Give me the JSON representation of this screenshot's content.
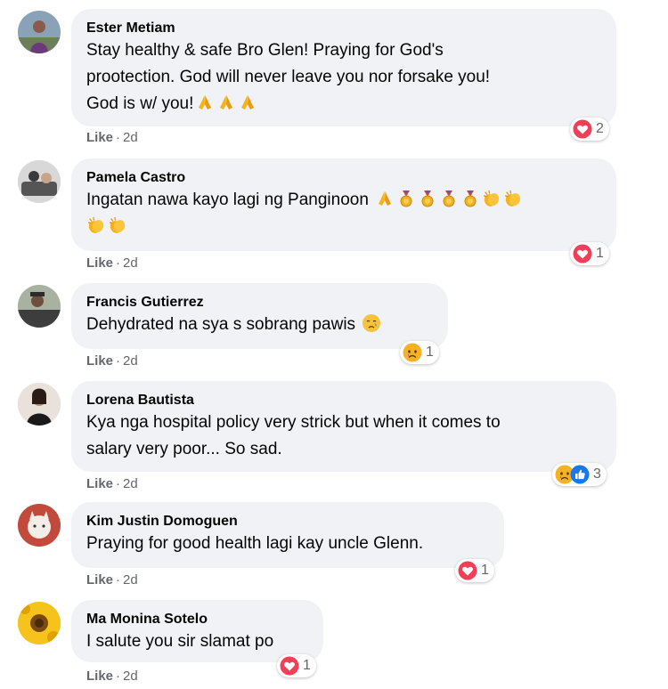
{
  "colors": {
    "bubble": "#f0f2f5",
    "meta": "#65676b",
    "heart": "#f33e58",
    "like": "#1877f2",
    "sad": "#f7b125"
  },
  "comments": [
    {
      "author": "Ester Metiam",
      "lines": [
        "Stay healthy & safe Bro Glen! Praying for God's",
        "prootection. God will never leave you nor forsake you!",
        "God is w/ you!"
      ],
      "emojis": [
        "folded-hands",
        "folded-hands",
        "folded-hands"
      ],
      "like": "Like",
      "time": "2d",
      "reactions": [
        "heart"
      ],
      "reaction_count": "2"
    },
    {
      "author": "Pamela Castro",
      "lines": [
        "Ingatan nawa kayo lagi ng Panginoon",
        ""
      ],
      "emojis": [
        "folded-hands",
        "medal",
        "medal",
        "medal",
        "medal",
        "clapping-hands",
        "clapping-hands",
        "clapping-hands",
        "clapping-hands"
      ],
      "like": "Like",
      "time": "2d",
      "reactions": [
        "heart"
      ],
      "reaction_count": "1"
    },
    {
      "author": "Francis Gutierrez",
      "lines": [
        "Dehydrated na sya s sobrang pawis"
      ],
      "emojis": [
        "sad-face"
      ],
      "like": "Like",
      "time": "2d",
      "reactions": [
        "sad"
      ],
      "reaction_count": "1"
    },
    {
      "author": "Lorena Bautista",
      "lines": [
        "Kya nga hospital policy very strick but when it comes to",
        "salary very poor... So sad."
      ],
      "emojis": [],
      "like": "Like",
      "time": "2d",
      "reactions": [
        "sad",
        "like"
      ],
      "reaction_count": "3"
    },
    {
      "author": "Kim Justin Domoguen",
      "lines": [
        "Praying for good health lagi kay uncle Glenn."
      ],
      "emojis": [],
      "like": "Like",
      "time": "2d",
      "reactions": [
        "heart"
      ],
      "reaction_count": "1"
    },
    {
      "author": "Ma Monina Sotelo",
      "lines": [
        "I salute you sir slamat po"
      ],
      "emojis": [],
      "like": "Like",
      "time": "2d",
      "reactions": [
        "heart"
      ],
      "reaction_count": "1"
    }
  ]
}
